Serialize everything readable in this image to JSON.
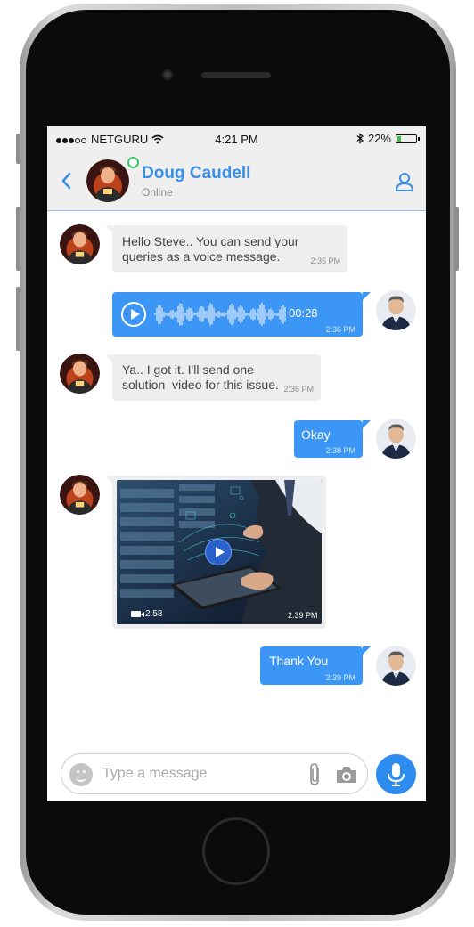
{
  "status_bar": {
    "carrier": "NETGURU",
    "time": "4:21 PM",
    "battery": "22%",
    "battery_level": 0.22,
    "signal_bars": 3
  },
  "header": {
    "contact_name": "Doug Caudell",
    "presence": "Online"
  },
  "messages": [
    {
      "type": "text",
      "direction": "incoming",
      "lines": [
        "Hello Steve.. You can send your",
        "queries as a voice message."
      ],
      "time": "2:35 PM"
    },
    {
      "type": "voice",
      "direction": "outgoing",
      "duration": "00:28",
      "time": "2:36 PM"
    },
    {
      "type": "text",
      "direction": "incoming",
      "lines": [
        "Ya.. I got it. I'll send one",
        "solution  video for this issue."
      ],
      "time": "2:36 PM"
    },
    {
      "type": "text",
      "direction": "outgoing",
      "text": "Okay",
      "time": "2:38 PM"
    },
    {
      "type": "video",
      "direction": "incoming",
      "duration": "2:58",
      "time": "2:39 PM"
    },
    {
      "type": "text",
      "direction": "outgoing",
      "text": "Thank You",
      "time": "2:39 PM"
    }
  ],
  "composer": {
    "placeholder": "Type a message"
  },
  "colors": {
    "accent": "#3b96f5",
    "incoming_bubble": "#eeeeee",
    "online": "#3cc46a",
    "battery_fill": "#3dc13c"
  },
  "icons": [
    "back-chevron-icon",
    "profile-icon",
    "play-icon",
    "waveform-icon",
    "video-camera-icon",
    "emoji-icon",
    "attachment-icon",
    "camera-icon",
    "microphone-icon"
  ]
}
